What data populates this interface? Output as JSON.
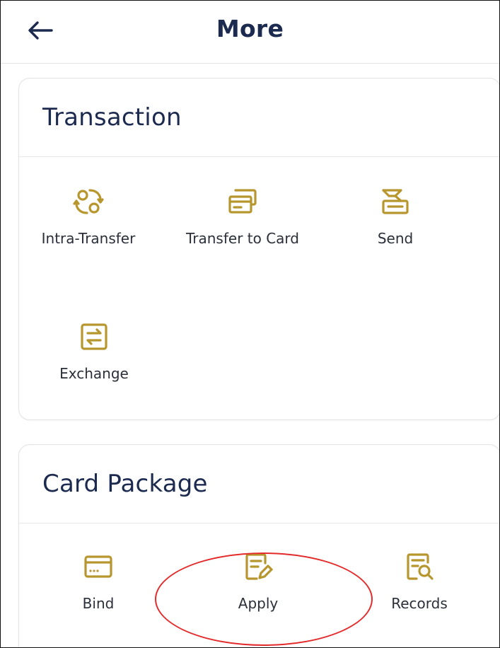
{
  "header": {
    "title": "More",
    "back_icon": "arrow-left-icon"
  },
  "accent_color": "#b8962e",
  "sections": {
    "transaction": {
      "title": "Transaction",
      "items": [
        {
          "label": "Intra-Transfer",
          "icon": "swap-circle-icon"
        },
        {
          "label": "Transfer to Card",
          "icon": "cards-icon"
        },
        {
          "label": "Send",
          "icon": "send-box-icon"
        },
        {
          "label": "Exchange",
          "icon": "exchange-icon"
        }
      ]
    },
    "card_package": {
      "title": "Card Package",
      "items": [
        {
          "label": "Bind",
          "icon": "card-icon"
        },
        {
          "label": "Apply",
          "icon": "edit-document-icon"
        },
        {
          "label": "Records",
          "icon": "search-document-icon"
        }
      ]
    }
  }
}
